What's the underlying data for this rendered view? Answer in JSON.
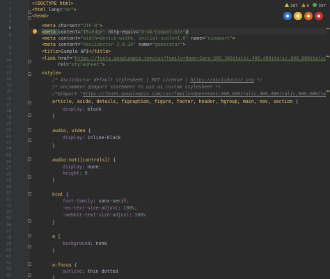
{
  "inspections": {
    "warnings": "287",
    "weak_warnings": "6",
    "typos": "307"
  },
  "browsers": [
    {
      "icon": "edge-icon",
      "color": "#3277bc"
    },
    {
      "icon": "chrome-icon",
      "color": "#e5b93b"
    },
    {
      "icon": "firefox-icon",
      "color": "#d86a25"
    },
    {
      "icon": "opera-icon",
      "color": "#c4323a"
    }
  ],
  "current_line": 5,
  "line_numbers": [
    "1",
    "2",
    "3",
    "4",
    "5",
    "6",
    "7",
    "8",
    "9",
    "10",
    "11",
    "12",
    "13",
    "14",
    "15",
    "16",
    "17",
    "18",
    "19",
    "20",
    "21",
    "22",
    "23",
    "24",
    "25",
    "26",
    "27",
    "28",
    "29",
    "30",
    "31",
    "32",
    "33",
    "34",
    "35",
    "36",
    "37",
    "38",
    "39",
    "40",
    "41",
    "42",
    "43",
    "44"
  ],
  "code": {
    "l1": [
      "<!DOCTYPE html>"
    ],
    "l2": [
      "<html ",
      "lang",
      "=",
      "\"en\"",
      ">"
    ],
    "l3": [
      "<head>"
    ],
    "l4": [
      "<meta ",
      "charset",
      "=",
      "\"UTF-8\"",
      ">"
    ],
    "l5": [
      "<meta ",
      "content",
      "=",
      "\"IE=edge\"",
      " ",
      "http-equiv",
      "=",
      "\"X-UA-Compatible\"",
      ">"
    ],
    "l6": [
      "<meta ",
      "content",
      "=",
      "\"width=device-width, initial-scale=1.0\"",
      " ",
      "name",
      "=",
      "\"viewport\"",
      ">"
    ],
    "l7": [
      "<meta ",
      "content",
      "=",
      "\"Asciidoctor 2.0.10\"",
      " ",
      "name",
      "=",
      "\"generator\"",
      ">"
    ],
    "l8": [
      "<title>",
      "Sample API",
      "</title>"
    ],
    "l9": [
      "<link ",
      "href",
      "=",
      "\"",
      "https://fonts.googleapis.com/css?family=Open+Sans:300,300italic,400,400italic,600,600italic%7CNoto+S"
    ],
    "l10": [
      "rel",
      "=",
      "\"stylesheet\"",
      ">"
    ],
    "l11": [
      "<style>"
    ],
    "l12": [
      "/* Asciidoctor default stylesheet | MIT License | ",
      "https://asciidoctor.org",
      " */"
    ],
    "l13": [
      "/* Uncomment @import statement to use as custom stylesheet */"
    ],
    "l14": [
      "/*@import \"",
      "https://fonts.googleapis.com/css?family=Open+Sans:300,300italic,400,400italic,600,600italic%7CNoto+Se"
    ],
    "l15": [
      "article, aside, details, figcaption, figure, footer, header, hgroup, main, nav, section",
      " {"
    ],
    "l16": [
      "display",
      ": ",
      "block"
    ],
    "l17": [
      "}"
    ],
    "l19": [
      "audio, video",
      " {"
    ],
    "l20": [
      "display",
      ": ",
      "inline-block"
    ],
    "l21": [
      "}"
    ],
    "l23": [
      "audio:not([controls])",
      " {"
    ],
    "l24": [
      "display",
      ": ",
      "none",
      ";"
    ],
    "l25": [
      "height",
      ": ",
      "0"
    ],
    "l26": [
      "}"
    ],
    "l28": [
      "html",
      " {"
    ],
    "l29": [
      "font-family",
      ": ",
      "sans-serif",
      ";"
    ],
    "l30": [
      "-ms-text-size-adjust",
      ": ",
      "100",
      "%",
      ";"
    ],
    "l31": [
      "-webkit-text-size-adjust",
      ": ",
      "100",
      "%"
    ],
    "l32": [
      "}"
    ],
    "l34": [
      "a",
      " {"
    ],
    "l35": [
      "background",
      ": ",
      "none"
    ],
    "l36": [
      "}"
    ],
    "l38": [
      "a:focus",
      " {"
    ],
    "l39": [
      "outline",
      ": ",
      "thin dotted"
    ],
    "l40": [
      "}"
    ]
  }
}
